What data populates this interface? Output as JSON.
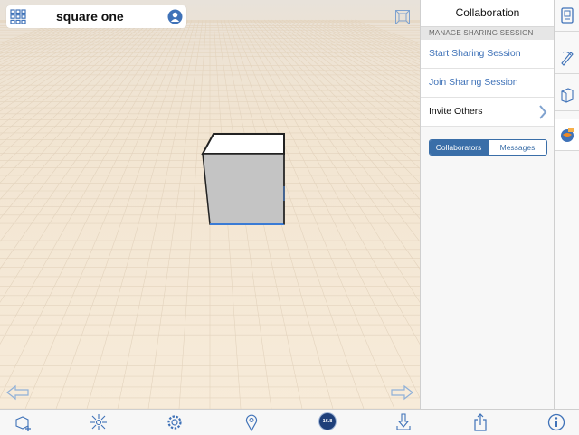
{
  "document": {
    "title": "square one"
  },
  "panel": {
    "title": "Collaboration",
    "section_heading": "MANAGE SHARING SESSION",
    "items": [
      {
        "label": "Start Sharing Session"
      },
      {
        "label": "Join Sharing Session"
      },
      {
        "label": "Invite Others"
      }
    ],
    "segments": {
      "collaborators": "Collaborators",
      "messages": "Messages",
      "selected": "Collaborators"
    }
  },
  "toolbar": {
    "units_badge": "16.8"
  },
  "colors": {
    "accent": "#3f72b8",
    "badge": "#1e3f7a",
    "cube_top": "#ffffff",
    "cube_front": "#c4c4c4"
  },
  "icons": {
    "title_left": "grid-menu-icon",
    "title_right": "user-profile-icon",
    "viewcube": "viewcube-icon",
    "undo": "undo-arrow-icon",
    "redo": "redo-arrow-icon",
    "sidebar": [
      "model-browser-icon",
      "drawing-icon",
      "materials-icon",
      "collaboration-icon"
    ],
    "toolbar": [
      "add-shape-icon",
      "snap-icon",
      "settings-icon",
      "location-pin-icon",
      "units-badge",
      "import-icon",
      "share-icon",
      "info-icon"
    ]
  }
}
